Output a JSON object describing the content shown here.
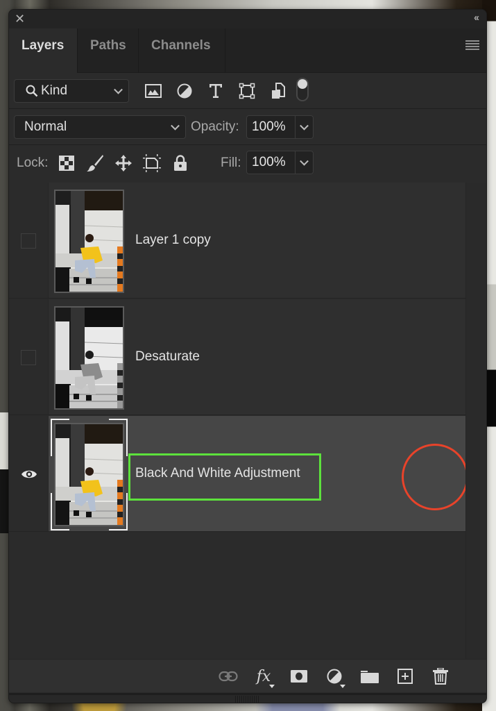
{
  "panel": {
    "close_icon": "close-icon",
    "collapse_label": "‹‹",
    "tabs": [
      {
        "label": "Layers",
        "active": true
      },
      {
        "label": "Paths",
        "active": false
      },
      {
        "label": "Channels",
        "active": false
      }
    ],
    "menu_icon": "hamburger-menu-icon"
  },
  "filter": {
    "kind_label": "Kind",
    "icons": [
      "pixel-layer-filter-icon",
      "adjustment-layer-filter-icon",
      "type-layer-filter-icon",
      "shape-layer-filter-icon",
      "smart-object-filter-icon"
    ],
    "toggle_on": true
  },
  "blend": {
    "mode": "Normal",
    "opacity_label": "Opacity:",
    "opacity_value": "100%"
  },
  "lock": {
    "label": "Lock:",
    "icons": [
      "lock-transparent-pixels-icon",
      "lock-image-pixels-icon",
      "lock-position-icon",
      "lock-artboard-icon",
      "lock-all-icon"
    ],
    "fill_label": "Fill:",
    "fill_value": "100%"
  },
  "layers": [
    {
      "name": "Layer 1 copy",
      "visible": false,
      "selected": false,
      "thumbnail": "color"
    },
    {
      "name": "Desaturate",
      "visible": false,
      "selected": false,
      "thumbnail": "grayscale"
    },
    {
      "name": "Black And White Adjustment",
      "visible": true,
      "selected": true,
      "thumbnail": "color"
    }
  ],
  "annotations": {
    "highlight_color": "#5de23c",
    "circle_color": "#e8432a"
  },
  "footer": {
    "icons": [
      "link-layers-icon",
      "fx-layer-style-icon",
      "add-mask-icon",
      "new-adjustment-layer-icon",
      "new-group-icon",
      "new-layer-icon",
      "delete-layer-icon"
    ],
    "fx_label": "fx"
  }
}
